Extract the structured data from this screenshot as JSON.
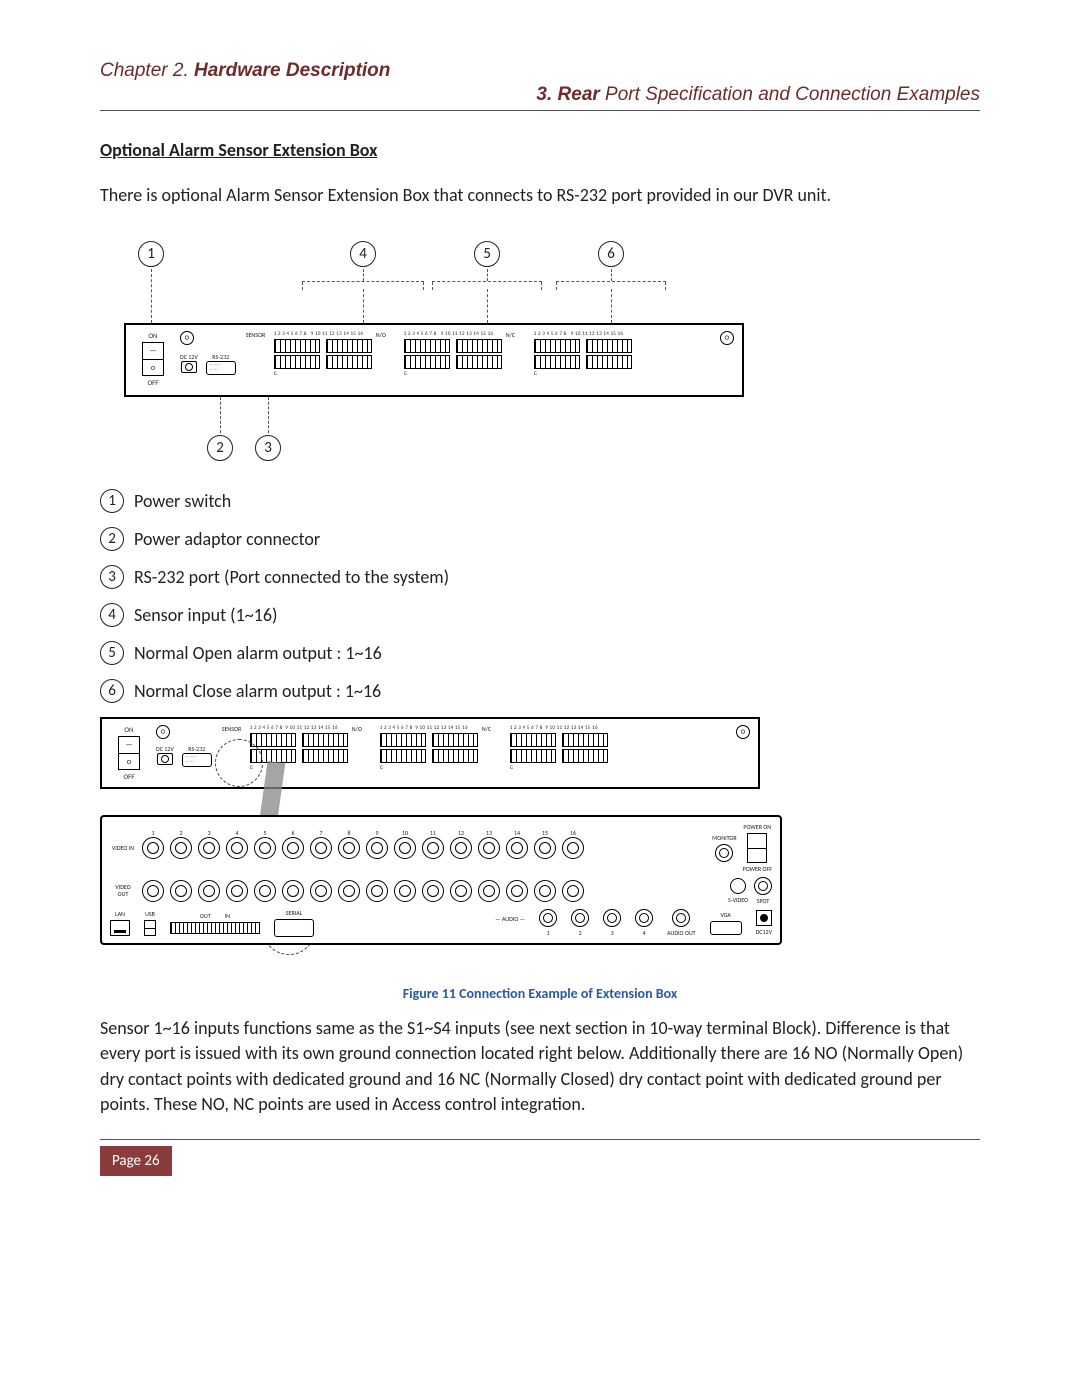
{
  "header": {
    "chapter_prefix": "Chapter 2. ",
    "chapter_bold": "Hardware Description",
    "section_bold": "3. Rear",
    "section_rest": " Port Specification and Connection Examples"
  },
  "subhead": "Optional Alarm Sensor Extension Box",
  "intro": "There is optional Alarm Sensor Extension Box that connects to RS-232 port provided in our DVR unit.",
  "callouts": {
    "top": [
      "1",
      "4",
      "5",
      "6"
    ],
    "bottom": [
      "2",
      "3"
    ]
  },
  "panel1": {
    "on": "ON",
    "off": "OFF",
    "dc": "DC 12V",
    "rs232": "RS-232",
    "group_sensor": "SENSOR",
    "group_no": "N/O",
    "group_nc": "N/C",
    "nums_a": "1 2 3 4 5 6 7 8",
    "nums_b": "9 10 11 12 13 14 15 16",
    "g": "G"
  },
  "legend": [
    {
      "n": "1",
      "t": "Power switch"
    },
    {
      "n": "2",
      "t": "Power adaptor connector"
    },
    {
      "n": "3",
      "t": "RS-232 port (Port connected to the system)"
    },
    {
      "n": "4",
      "t": "Sensor input (1~16)"
    },
    {
      "n": "5",
      "t": "Normal Open alarm output : 1~16"
    },
    {
      "n": "6",
      "t": "Normal Close alarm output : 1~16"
    }
  ],
  "dvr": {
    "video_in": "VIDEO IN",
    "video_out": "VIDEO OUT",
    "lan": "LAN",
    "usb": "USB",
    "out": "OUT",
    "in": "IN",
    "serial": "SERIAL",
    "audio": "AUDIO",
    "audio_out": "AUDIO OUT",
    "monitor": "MONITOR",
    "svideo": "S-VIDEO",
    "spot": "SPOT",
    "vga": "VGA",
    "power_on": "POWER ON",
    "power_off": "POWER OFF",
    "dc12v": "DC12V",
    "chn": [
      "1",
      "2",
      "3",
      "4",
      "5",
      "6",
      "7",
      "8",
      "9",
      "10",
      "11",
      "12",
      "13",
      "14",
      "15",
      "16"
    ],
    "audio_chn": [
      "1",
      "2",
      "3",
      "4"
    ]
  },
  "figure_caption": "Figure 11 Connection Example of Extension Box",
  "body2": "Sensor 1~16 inputs functions same as the S1~S4 inputs (see next section in 10-way terminal Block). Difference is that every port is issued with its own ground connection located right below. Additionally there are 16 NO (Normally Open) dry contact points with dedicated ground and 16 NC (Normally Closed) dry contact point with dedicated ground per points.  These NO, NC points are used in Access control integration.",
  "page": "Page 26"
}
